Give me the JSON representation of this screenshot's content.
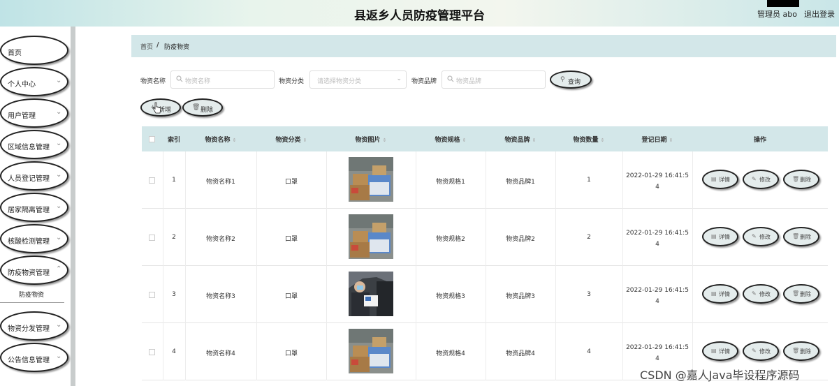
{
  "header": {
    "title": "县返乡人员防疫管理平台",
    "user_label": "管理员 abo",
    "logout_label": "退出登录"
  },
  "sidebar": {
    "items": [
      {
        "label": "首页",
        "chevron": false
      },
      {
        "label": "个人中心",
        "chevron": true
      },
      {
        "label": "用户管理",
        "chevron": true
      },
      {
        "label": "区域信息管理",
        "chevron": true
      },
      {
        "label": "人员登记管理",
        "chevron": true
      },
      {
        "label": "居家隔离管理",
        "chevron": true
      },
      {
        "label": "核酸检测管理",
        "chevron": true
      },
      {
        "label": "防疫物资管理",
        "chevron": true
      },
      {
        "label": "物资分发管理",
        "chevron": true
      },
      {
        "label": "公告信息管理",
        "chevron": true
      }
    ],
    "submenu_label": "防疫物资"
  },
  "breadcrumb": {
    "home": "首页",
    "separator": "/",
    "current": "防疫物资"
  },
  "search": {
    "name_label": "物资名称",
    "name_placeholder": "物资名称",
    "category_label": "物资分类",
    "category_placeholder": "请选择物资分类",
    "brand_label": "物资品牌",
    "brand_placeholder": "物资品牌",
    "query_button": "查询"
  },
  "actions": {
    "add_button": "新增",
    "delete_button": "删除"
  },
  "table": {
    "headers": {
      "index": "索引",
      "name": "物资名称",
      "category": "物资分类",
      "image": "物资图片",
      "spec": "物资规格",
      "brand": "物资品牌",
      "quantity": "物资数量",
      "date": "登记日期",
      "ops": "操作"
    },
    "rows": [
      {
        "index": "1",
        "name": "物资名称1",
        "category": "口罩",
        "spec": "物资规格1",
        "brand": "物资品牌1",
        "quantity": "1",
        "date_line1": "2022-01-29 16:41:5",
        "date_line2": "4"
      },
      {
        "index": "2",
        "name": "物资名称2",
        "category": "口罩",
        "spec": "物资规格2",
        "brand": "物资品牌2",
        "quantity": "2",
        "date_line1": "2022-01-29 16:41:5",
        "date_line2": "4"
      },
      {
        "index": "3",
        "name": "物资名称3",
        "category": "口罩",
        "spec": "物资规格3",
        "brand": "物资品牌3",
        "quantity": "3",
        "date_line1": "2022-01-29 16:41:5",
        "date_line2": "4"
      },
      {
        "index": "4",
        "name": "物资名称4",
        "category": "口罩",
        "spec": "物资规格4",
        "brand": "物资品牌4",
        "quantity": "4",
        "date_line1": "2022-01-29 16:41:5",
        "date_line2": "4"
      }
    ],
    "op_labels": {
      "detail": "详情",
      "edit": "修改",
      "delete": "删除"
    }
  },
  "watermark": "CSDN @嘉人Java毕设程序源码"
}
